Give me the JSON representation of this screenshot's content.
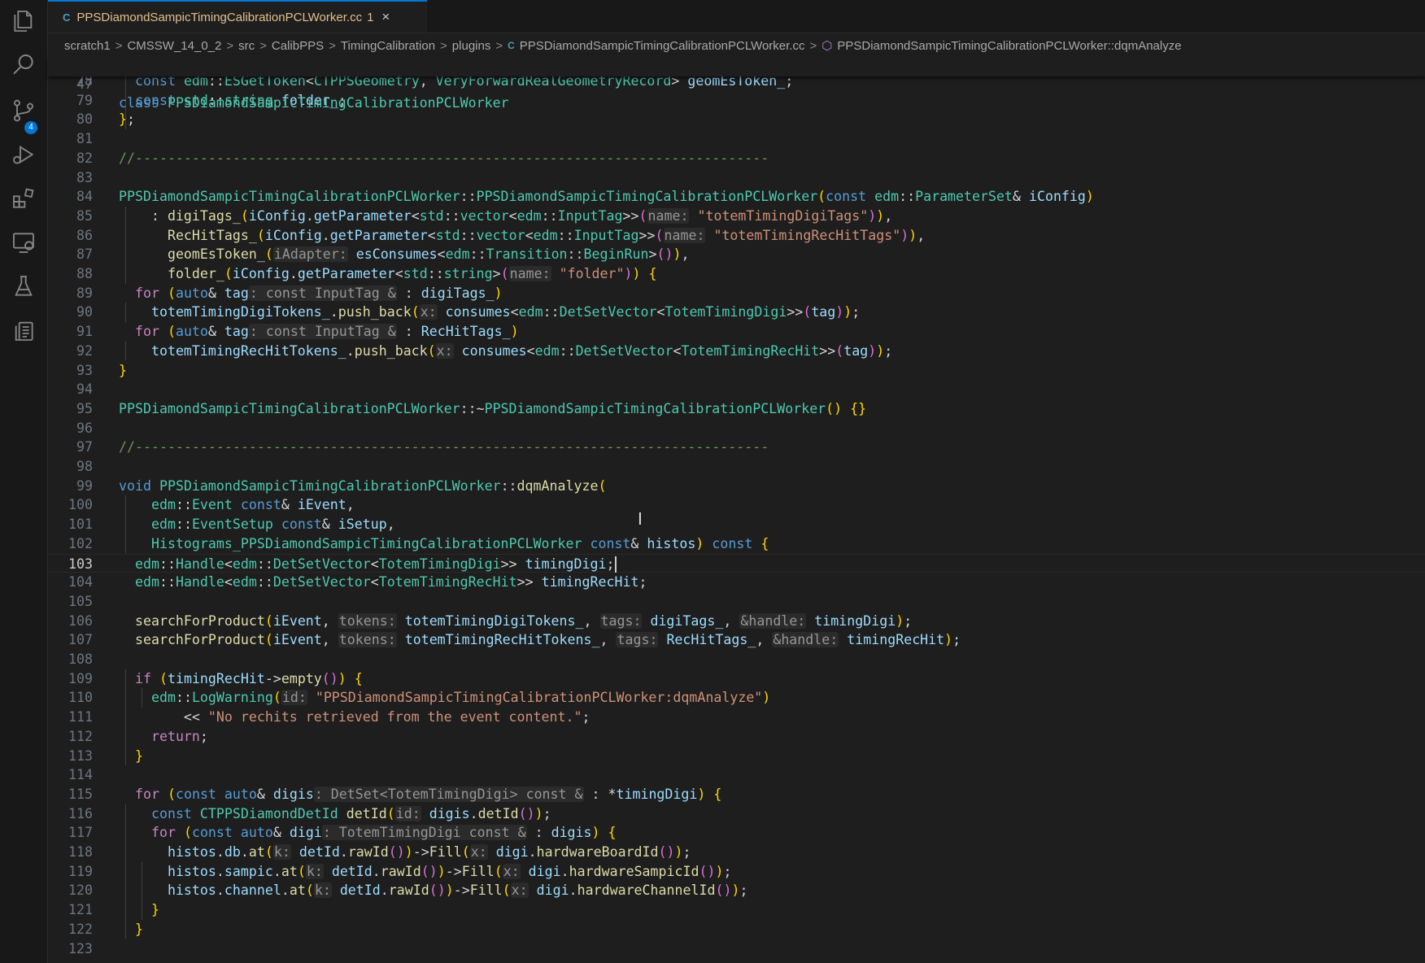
{
  "activity_bar": {
    "icons": [
      "explorer-icon",
      "search-icon",
      "source-control-icon",
      "run-debug-icon",
      "extensions-icon",
      "remote-explorer-icon",
      "testing-icon",
      "clipboard-icon"
    ],
    "scm_badge": "4"
  },
  "tab": {
    "label": "PPSDiamondSampicTimingCalibrationPCLWorker.cc",
    "problems": "1",
    "close_glyph": "×",
    "file_glyph": "C"
  },
  "breadcrumb": {
    "items": [
      "scratch1",
      "CMSSW_14_0_2",
      "src",
      "CalibPPS",
      "TimingCalibration",
      "plugins",
      "PPSDiamondSampicTimingCalibrationPCLWorker.cc",
      "PPSDiamondSampicTimingCalibrationPCLWorker::dqmAnalyze"
    ],
    "separator": ">",
    "file_glyph": "C",
    "symbol_glyph": "⬡"
  },
  "sticky": {
    "line": "47",
    "text": "class PPSDiamondSampicTimingCalibrationPCLWorker"
  },
  "line_numbers": [
    "78",
    "79",
    "80",
    "81",
    "82",
    "83",
    "84",
    "85",
    "86",
    "87",
    "88",
    "89",
    "90",
    "91",
    "92",
    "93",
    "94",
    "95",
    "96",
    "97",
    "98",
    "99",
    "100",
    "101",
    "102",
    "103",
    "104",
    "105",
    "106",
    "107",
    "108",
    "109",
    "110",
    "111",
    "112",
    "113",
    "114",
    "115",
    "116",
    "117",
    "118",
    "119",
    "120",
    "121",
    "122",
    "123"
  ],
  "current_line": "103",
  "code": [
    "  const edm::ESGetToken<CTPPSGeometry, VeryForwardRealGeometryRecord> geomEsToken_;",
    "  const std::string folder_;",
    "};",
    "",
    "//------------------------------------------------------------------------------",
    "",
    "PPSDiamondSampicTimingCalibrationPCLWorker::PPSDiamondSampicTimingCalibrationPCLWorker(const edm::ParameterSet& iConfig)",
    "    : digiTags_(iConfig.getParameter<std::vector<edm::InputTag>>(name: \"totemTimingDigiTags\")),",
    "      RecHitTags_(iConfig.getParameter<std::vector<edm::InputTag>>(name: \"totemTimingRecHitTags\")),",
    "      geomEsToken_(iAdapter: esConsumes<edm::Transition::BeginRun>()),",
    "      folder_(iConfig.getParameter<std::string>(name: \"folder\")) {",
    "  for (auto& tag: const InputTag & : digiTags_)",
    "    totemTimingDigiTokens_.push_back(x: consumes<edm::DetSetVector<TotemTimingDigi>>(tag));",
    "  for (auto& tag: const InputTag & : RecHitTags_)",
    "    totemTimingRecHitTokens_.push_back(x: consumes<edm::DetSetVector<TotemTimingRecHit>>(tag));",
    "}",
    "",
    "PPSDiamondSampicTimingCalibrationPCLWorker::~PPSDiamondSampicTimingCalibrationPCLWorker() {}",
    "",
    "//------------------------------------------------------------------------------",
    "",
    "void PPSDiamondSampicTimingCalibrationPCLWorker::dqmAnalyze(",
    "    edm::Event const& iEvent,",
    "    edm::EventSetup const& iSetup,",
    "    Histograms_PPSDiamondSampicTimingCalibrationPCLWorker const& histos) const {",
    "  edm::Handle<edm::DetSetVector<TotemTimingDigi>> timingDigi;",
    "  edm::Handle<edm::DetSetVector<TotemTimingRecHit>> timingRecHit;",
    "",
    "  searchForProduct(iEvent, tokens: totemTimingDigiTokens_, tags: digiTags_, &handle: timingDigi);",
    "  searchForProduct(iEvent, tokens: totemTimingRecHitTokens_, tags: RecHitTags_, &handle: timingRecHit);",
    "",
    "  if (timingRecHit->empty()) {",
    "    edm::LogWarning(id: \"PPSDiamondSampicTimingCalibrationPCLWorker:dqmAnalyze\")",
    "        << \"No rechits retrieved from the event content.\";",
    "    return;",
    "  }",
    "",
    "  for (const auto& digis: DetSet<TotemTimingDigi> const & : *timingDigi) {",
    "    const CTPPSDiamondDetId detId(id: digis.detId());",
    "    for (const auto& digi: TotemTimingDigi const & : digis) {",
    "      histos.db.at(k: detId.rawId())->Fill(x: digi.hardwareBoardId());",
    "      histos.sampic.at(k: detId.rawId())->Fill(x: digi.hardwareSampicId());",
    "      histos.channel.at(k: detId.rawId())->Fill(x: digi.hardwareChannelId());",
    "    }",
    "  }",
    ""
  ]
}
